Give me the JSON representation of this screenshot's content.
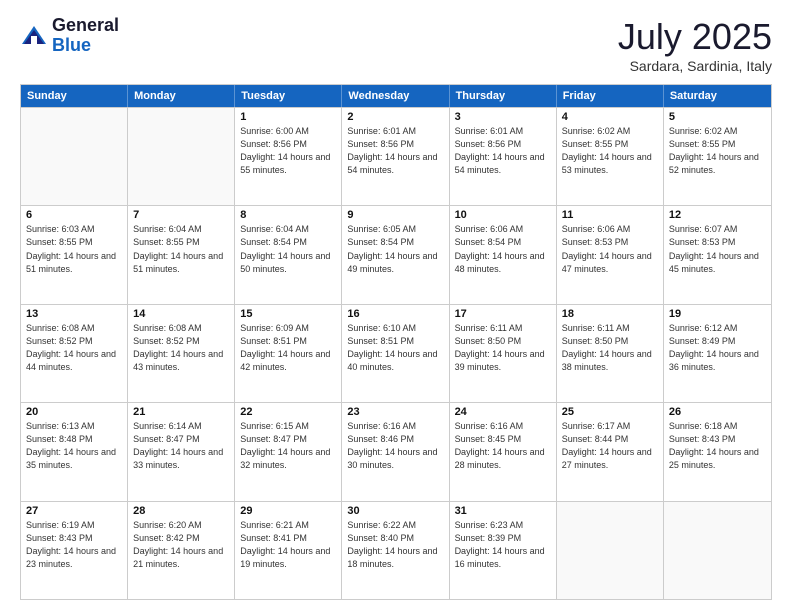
{
  "header": {
    "logo_general": "General",
    "logo_blue": "Blue",
    "month": "July 2025",
    "location": "Sardara, Sardinia, Italy"
  },
  "days_of_week": [
    "Sunday",
    "Monday",
    "Tuesday",
    "Wednesday",
    "Thursday",
    "Friday",
    "Saturday"
  ],
  "weeks": [
    [
      {
        "day": "",
        "info": ""
      },
      {
        "day": "",
        "info": ""
      },
      {
        "day": "1",
        "info": "Sunrise: 6:00 AM\nSunset: 8:56 PM\nDaylight: 14 hours and 55 minutes."
      },
      {
        "day": "2",
        "info": "Sunrise: 6:01 AM\nSunset: 8:56 PM\nDaylight: 14 hours and 54 minutes."
      },
      {
        "day": "3",
        "info": "Sunrise: 6:01 AM\nSunset: 8:56 PM\nDaylight: 14 hours and 54 minutes."
      },
      {
        "day": "4",
        "info": "Sunrise: 6:02 AM\nSunset: 8:55 PM\nDaylight: 14 hours and 53 minutes."
      },
      {
        "day": "5",
        "info": "Sunrise: 6:02 AM\nSunset: 8:55 PM\nDaylight: 14 hours and 52 minutes."
      }
    ],
    [
      {
        "day": "6",
        "info": "Sunrise: 6:03 AM\nSunset: 8:55 PM\nDaylight: 14 hours and 51 minutes."
      },
      {
        "day": "7",
        "info": "Sunrise: 6:04 AM\nSunset: 8:55 PM\nDaylight: 14 hours and 51 minutes."
      },
      {
        "day": "8",
        "info": "Sunrise: 6:04 AM\nSunset: 8:54 PM\nDaylight: 14 hours and 50 minutes."
      },
      {
        "day": "9",
        "info": "Sunrise: 6:05 AM\nSunset: 8:54 PM\nDaylight: 14 hours and 49 minutes."
      },
      {
        "day": "10",
        "info": "Sunrise: 6:06 AM\nSunset: 8:54 PM\nDaylight: 14 hours and 48 minutes."
      },
      {
        "day": "11",
        "info": "Sunrise: 6:06 AM\nSunset: 8:53 PM\nDaylight: 14 hours and 47 minutes."
      },
      {
        "day": "12",
        "info": "Sunrise: 6:07 AM\nSunset: 8:53 PM\nDaylight: 14 hours and 45 minutes."
      }
    ],
    [
      {
        "day": "13",
        "info": "Sunrise: 6:08 AM\nSunset: 8:52 PM\nDaylight: 14 hours and 44 minutes."
      },
      {
        "day": "14",
        "info": "Sunrise: 6:08 AM\nSunset: 8:52 PM\nDaylight: 14 hours and 43 minutes."
      },
      {
        "day": "15",
        "info": "Sunrise: 6:09 AM\nSunset: 8:51 PM\nDaylight: 14 hours and 42 minutes."
      },
      {
        "day": "16",
        "info": "Sunrise: 6:10 AM\nSunset: 8:51 PM\nDaylight: 14 hours and 40 minutes."
      },
      {
        "day": "17",
        "info": "Sunrise: 6:11 AM\nSunset: 8:50 PM\nDaylight: 14 hours and 39 minutes."
      },
      {
        "day": "18",
        "info": "Sunrise: 6:11 AM\nSunset: 8:50 PM\nDaylight: 14 hours and 38 minutes."
      },
      {
        "day": "19",
        "info": "Sunrise: 6:12 AM\nSunset: 8:49 PM\nDaylight: 14 hours and 36 minutes."
      }
    ],
    [
      {
        "day": "20",
        "info": "Sunrise: 6:13 AM\nSunset: 8:48 PM\nDaylight: 14 hours and 35 minutes."
      },
      {
        "day": "21",
        "info": "Sunrise: 6:14 AM\nSunset: 8:47 PM\nDaylight: 14 hours and 33 minutes."
      },
      {
        "day": "22",
        "info": "Sunrise: 6:15 AM\nSunset: 8:47 PM\nDaylight: 14 hours and 32 minutes."
      },
      {
        "day": "23",
        "info": "Sunrise: 6:16 AM\nSunset: 8:46 PM\nDaylight: 14 hours and 30 minutes."
      },
      {
        "day": "24",
        "info": "Sunrise: 6:16 AM\nSunset: 8:45 PM\nDaylight: 14 hours and 28 minutes."
      },
      {
        "day": "25",
        "info": "Sunrise: 6:17 AM\nSunset: 8:44 PM\nDaylight: 14 hours and 27 minutes."
      },
      {
        "day": "26",
        "info": "Sunrise: 6:18 AM\nSunset: 8:43 PM\nDaylight: 14 hours and 25 minutes."
      }
    ],
    [
      {
        "day": "27",
        "info": "Sunrise: 6:19 AM\nSunset: 8:43 PM\nDaylight: 14 hours and 23 minutes."
      },
      {
        "day": "28",
        "info": "Sunrise: 6:20 AM\nSunset: 8:42 PM\nDaylight: 14 hours and 21 minutes."
      },
      {
        "day": "29",
        "info": "Sunrise: 6:21 AM\nSunset: 8:41 PM\nDaylight: 14 hours and 19 minutes."
      },
      {
        "day": "30",
        "info": "Sunrise: 6:22 AM\nSunset: 8:40 PM\nDaylight: 14 hours and 18 minutes."
      },
      {
        "day": "31",
        "info": "Sunrise: 6:23 AM\nSunset: 8:39 PM\nDaylight: 14 hours and 16 minutes."
      },
      {
        "day": "",
        "info": ""
      },
      {
        "day": "",
        "info": ""
      }
    ]
  ]
}
